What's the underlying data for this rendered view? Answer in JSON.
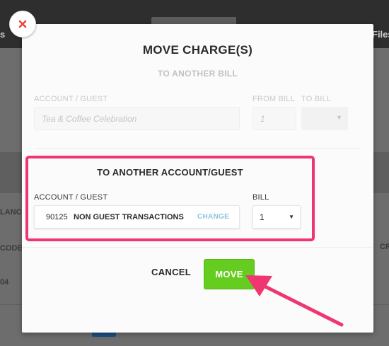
{
  "background": {
    "left_tab_fragment": "s",
    "right_tab_label": "Files",
    "left_text_1": "LANCE",
    "left_text_2": "CODE",
    "left_text_3": "04",
    "right_header_fragment": "CR"
  },
  "modal": {
    "title": "MOVE CHARGE(S)",
    "to_another_bill": {
      "heading": "TO ANOTHER BILL",
      "account_label": "ACCOUNT / GUEST",
      "account_placeholder": "Tea & Coffee Celebration",
      "from_bill_label": "FROM BILL",
      "from_bill_value": "1",
      "to_bill_label": "TO BILL"
    },
    "to_another_account": {
      "heading": "TO ANOTHER ACCOUNT/GUEST",
      "account_label": "ACCOUNT / GUEST",
      "account_number": "90125",
      "account_name": "NON GUEST TRANSACTIONS",
      "change_label": "CHANGE",
      "bill_label": "BILL",
      "bill_value": "1"
    },
    "cancel_label": "CANCEL",
    "move_label": "MOVE"
  },
  "colors": {
    "highlight": "#f03670",
    "move_button": "#65cc20",
    "change_link": "#8cc4e0",
    "close_icon": "#e8453c",
    "arrow": "#f03670"
  },
  "icons": {
    "close": "close-icon",
    "dropdown": "caret-down-icon",
    "annotation": "arrow-annotation"
  }
}
